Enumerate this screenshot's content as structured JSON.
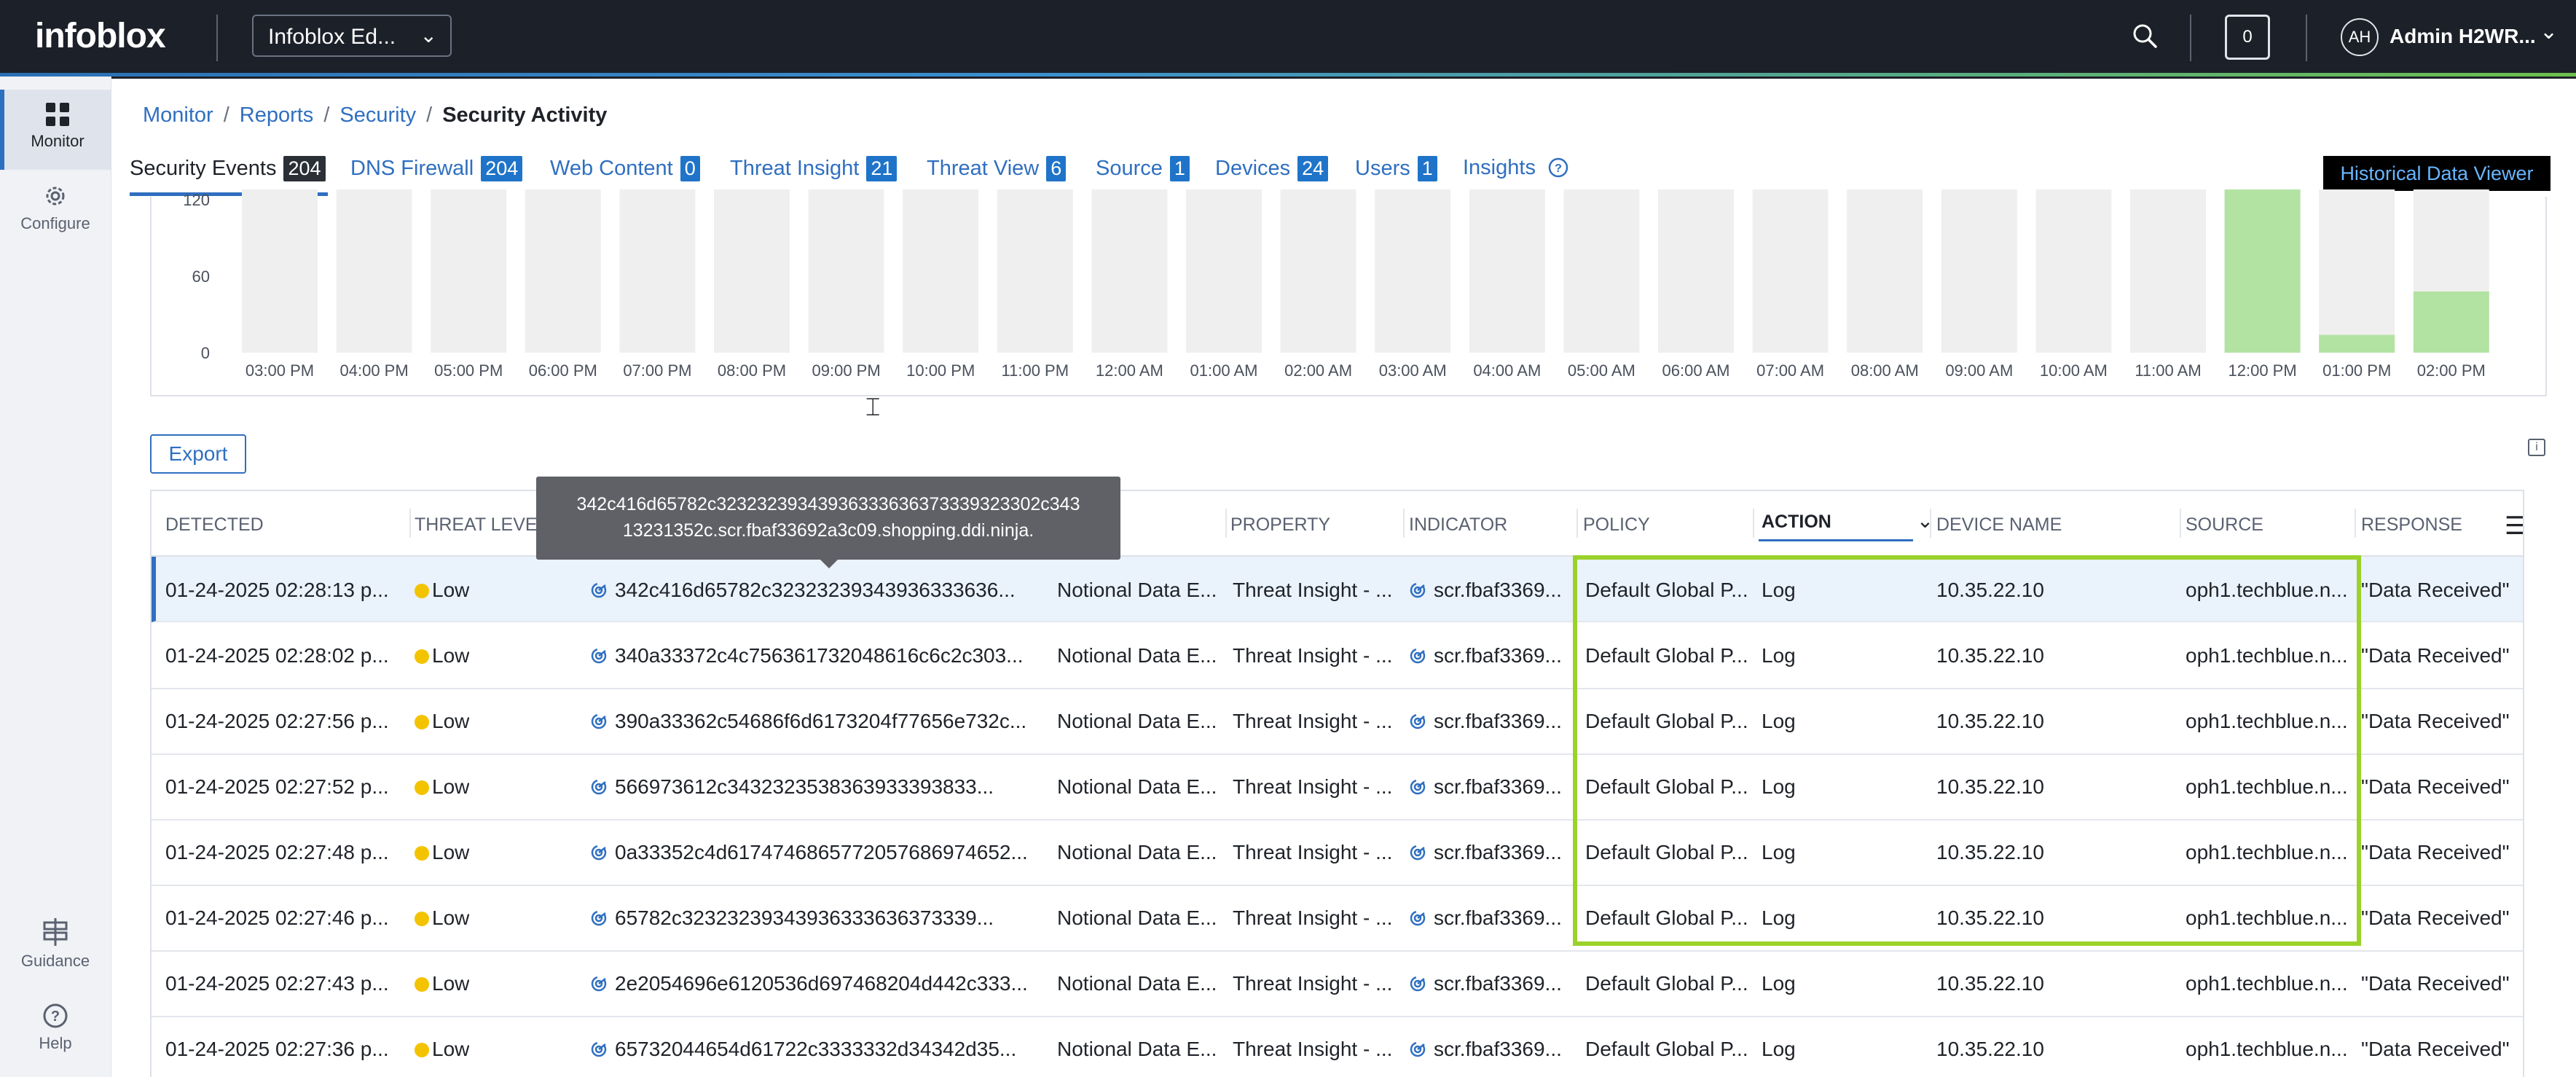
{
  "app": {
    "logo": "infoblox",
    "product_select": "Infoblox Ed...",
    "notifications_count": "0",
    "user_initials": "AH",
    "user_name": "Admin H2WR..."
  },
  "sidenav": {
    "items": [
      {
        "label": "Monitor",
        "icon": "dashboard-grid-icon",
        "active": true
      },
      {
        "label": "Configure",
        "icon": "gear-icon"
      },
      {
        "label": "Guidance",
        "icon": "signpost-icon"
      },
      {
        "label": "Help",
        "icon": "question-circle-icon"
      }
    ]
  },
  "breadcrumb": [
    "Monitor",
    "Reports",
    "Security",
    "Security Activity"
  ],
  "tabs": [
    {
      "label": "Security Events",
      "count": "204",
      "active": true
    },
    {
      "label": "DNS Firewall",
      "count": "204"
    },
    {
      "label": "Web Content",
      "count": "0"
    },
    {
      "label": "Threat Insight",
      "count": "21"
    },
    {
      "label": "Threat View",
      "count": "6"
    },
    {
      "label": "Source",
      "count": "1"
    },
    {
      "label": "Devices",
      "count": "24"
    },
    {
      "label": "Users",
      "count": "1"
    },
    {
      "label": "Insights",
      "count": ""
    }
  ],
  "historical_button": "Historical Data Viewer",
  "chart_data": {
    "type": "bar",
    "categories": [
      "03:00 PM",
      "04:00 PM",
      "05:00 PM",
      "06:00 PM",
      "07:00 PM",
      "08:00 PM",
      "09:00 PM",
      "10:00 PM",
      "11:00 PM",
      "12:00 AM",
      "01:00 AM",
      "02:00 AM",
      "03:00 AM",
      "04:00 AM",
      "05:00 AM",
      "06:00 AM",
      "07:00 AM",
      "08:00 AM",
      "09:00 AM",
      "10:00 AM",
      "11:00 AM",
      "12:00 PM",
      "01:00 PM",
      "02:00 PM"
    ],
    "values": [
      0,
      0,
      0,
      0,
      0,
      0,
      0,
      0,
      0,
      0,
      0,
      0,
      0,
      0,
      0,
      0,
      0,
      0,
      0,
      0,
      0,
      130,
      14,
      48
    ],
    "ylim": [
      0,
      120
    ],
    "yticks": [
      "120",
      "60",
      "0"
    ],
    "bar_color": "#b3e3a3",
    "bg_bar_color": "#efefef"
  },
  "export_label": "Export",
  "tooltip": "342c416d65782c32323239343936333636373339323302c343 13231352c.scr.fbaf33692a3c09.shopping.ddi.ninja.",
  "table": {
    "columns": [
      "DETECTED",
      "THREAT LEVEL",
      "",
      "",
      "PROPERTY",
      "INDICATOR",
      "POLICY",
      "ACTION",
      "DEVICE NAME",
      "SOURCE",
      "RESPONSE"
    ],
    "rows": [
      {
        "detected": "01-24-2025 02:28:13 p...",
        "level": "Low",
        "query": "342c416d65782c32323239343936333636...",
        "feed": "Notional Data E...",
        "property": "Threat Insight - ...",
        "indicator": "scr.fbaf3369...",
        "policy": "Default Global P...",
        "action": "Log",
        "device": "10.35.22.10",
        "source": "oph1.techblue.n...",
        "response": "\"Data Received\""
      },
      {
        "detected": "01-24-2025 02:28:02 p...",
        "level": "Low",
        "query": "340a33372c4c756361732048616c6c2c303...",
        "feed": "Notional Data E...",
        "property": "Threat Insight - ...",
        "indicator": "scr.fbaf3369...",
        "policy": "Default Global P...",
        "action": "Log",
        "device": "10.35.22.10",
        "source": "oph1.techblue.n...",
        "response": "\"Data Received\""
      },
      {
        "detected": "01-24-2025 02:27:56 p...",
        "level": "Low",
        "query": "390a33362c54686f6d6173204f77656e732c...",
        "feed": "Notional Data E...",
        "property": "Threat Insight - ...",
        "indicator": "scr.fbaf3369...",
        "policy": "Default Global P...",
        "action": "Log",
        "device": "10.35.22.10",
        "source": "oph1.techblue.n...",
        "response": "\"Data Received\""
      },
      {
        "detected": "01-24-2025 02:27:52 p...",
        "level": "Low",
        "query": "566973612c3432323538363933393833...",
        "feed": "Notional Data E...",
        "property": "Threat Insight - ...",
        "indicator": "scr.fbaf3369...",
        "policy": "Default Global P...",
        "action": "Log",
        "device": "10.35.22.10",
        "source": "oph1.techblue.n...",
        "response": "\"Data Received\""
      },
      {
        "detected": "01-24-2025 02:27:48 p...",
        "level": "Low",
        "query": "0a33352c4d6174746865772057686974652...",
        "feed": "Notional Data E...",
        "property": "Threat Insight - ...",
        "indicator": "scr.fbaf3369...",
        "policy": "Default Global P...",
        "action": "Log",
        "device": "10.35.22.10",
        "source": "oph1.techblue.n...",
        "response": "\"Data Received\""
      },
      {
        "detected": "01-24-2025 02:27:46 p...",
        "level": "Low",
        "query": "65782c32323239343936333636373339...",
        "feed": "Notional Data E...",
        "property": "Threat Insight - ...",
        "indicator": "scr.fbaf3369...",
        "policy": "Default Global P...",
        "action": "Log",
        "device": "10.35.22.10",
        "source": "oph1.techblue.n...",
        "response": "\"Data Received\""
      },
      {
        "detected": "01-24-2025 02:27:43 p...",
        "level": "Low",
        "query": "2e2054696e6120536d697468204d442c333...",
        "feed": "Notional Data E...",
        "property": "Threat Insight - ...",
        "indicator": "scr.fbaf3369...",
        "policy": "Default Global P...",
        "action": "Log",
        "device": "10.35.22.10",
        "source": "oph1.techblue.n...",
        "response": "\"Data Received\""
      },
      {
        "detected": "01-24-2025 02:27:36 p...",
        "level": "Low",
        "query": "65732044654d61722c3333332d34342d35...",
        "feed": "Notional Data E...",
        "property": "Threat Insight - ...",
        "indicator": "scr.fbaf3369...",
        "policy": "Default Global P...",
        "action": "Log",
        "device": "10.35.22.10",
        "source": "oph1.techblue.n...",
        "response": "\"Data Received\""
      }
    ]
  }
}
